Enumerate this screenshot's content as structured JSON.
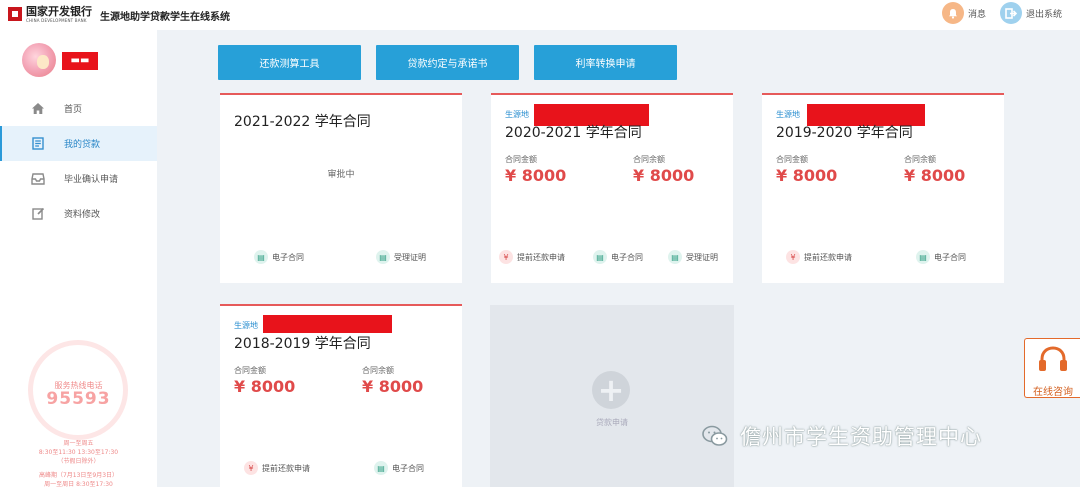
{
  "header": {
    "bank_name": "国家开发银行",
    "bank_name_en": "CHINA DEVELOPMENT BANK",
    "system_title": "生源地助学贷款学生在线系统",
    "messages_label": "消息",
    "logout_label": "退出系统"
  },
  "sidebar": {
    "user_name": "▬▬",
    "nav": [
      {
        "label": "首页",
        "icon": "home-icon"
      },
      {
        "label": "我的贷款",
        "icon": "loan-icon",
        "active": true
      },
      {
        "label": "毕业确认申请",
        "icon": "inbox-icon"
      },
      {
        "label": "资料修改",
        "icon": "edit-icon"
      }
    ],
    "hotline": {
      "label": "服务热线电话",
      "number": "95593",
      "hours_label": "周一至周五",
      "hours": "8:30至11:30  13:30至17:30",
      "hours_note": "（节假日除外）",
      "peak_label": "高峰期（7月13日至9月3日）",
      "peak_hours": "周一至周日 8:30至17:30"
    }
  },
  "top_buttons": [
    "还款测算工具",
    "贷款约定与承诺书",
    "利率转换申请"
  ],
  "contracts": [
    {
      "title": "2021-2022 学年合同",
      "status": "审批中",
      "actions": [
        {
          "label": "电子合同",
          "icon": "document-icon"
        },
        {
          "label": "受理证明",
          "icon": "document-icon"
        }
      ]
    },
    {
      "tag": "生源地",
      "title": "2020-2021 学年合同",
      "amount_label": "合同金额",
      "amount": "¥ 8000",
      "balance_label": "合同余额",
      "balance": "¥ 8000",
      "actions": [
        {
          "label": "提前还款申请",
          "icon": "yen-icon"
        },
        {
          "label": "电子合同",
          "icon": "document-icon"
        },
        {
          "label": "受理证明",
          "icon": "document-icon"
        }
      ]
    },
    {
      "tag": "生源地",
      "title": "2019-2020 学年合同",
      "amount_label": "合同金额",
      "amount": "¥ 8000",
      "balance_label": "合同余额",
      "balance": "¥ 8000",
      "actions": [
        {
          "label": "提前还款申请",
          "icon": "yen-icon"
        },
        {
          "label": "电子合同",
          "icon": "document-icon"
        }
      ]
    },
    {
      "tag": "生源地",
      "title": "2018-2019 学年合同",
      "amount_label": "合同金额",
      "amount": "¥ 8000",
      "balance_label": "合同余额",
      "balance": "¥ 8000",
      "actions": [
        {
          "label": "提前还款申请",
          "icon": "yen-icon"
        },
        {
          "label": "电子合同",
          "icon": "document-icon"
        }
      ]
    }
  ],
  "add_card": {
    "label": "贷款申请"
  },
  "consult": {
    "label": "在线咨询"
  },
  "watermark": {
    "text": "儋州市学生资助管理中心"
  },
  "colors": {
    "primary_button": "#27a0d8",
    "card_accent": "#e65a5a",
    "amount_red": "#e04a4a",
    "active_nav": "#2a87c8",
    "consult_orange": "#e36a2b"
  }
}
